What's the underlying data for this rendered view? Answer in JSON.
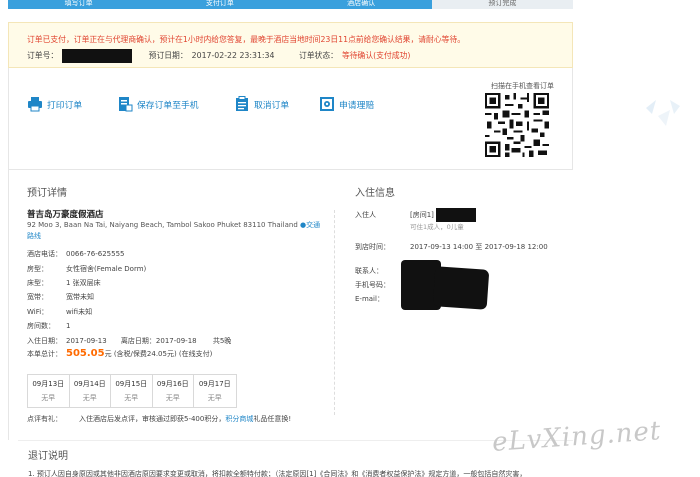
{
  "steps": [
    "填写订单",
    "支付订单",
    "酒店确认",
    "预订完成"
  ],
  "alert": {
    "message": "订单已支付，订单正在与代理商确认，预计在1小时内给您答复，最晚于酒店当地时间23日11点前给您确认结果，请耐心等待。",
    "order_no_label": "订单号：",
    "order_date_label": "预订日期：",
    "order_date": "2017-02-22 23:31:34",
    "order_status_label": "订单状态：",
    "order_status": "等待确认(支付成功)"
  },
  "actions": {
    "print": "打印订单",
    "save": "保存订单至手机",
    "cancel": "取消订单",
    "claim": "申请理赔",
    "qr_label": "扫描在手机查看订单"
  },
  "booking": {
    "section_title": "预订详情",
    "hotel_name": "普吉岛万豪度假酒店",
    "hotel_address": "92 Moo 3, Baan Na Tai, Naiyang Beach, Tambol Sakoo Phuket 83110 Thailand",
    "traffic_link": "交通路线",
    "rows": [
      {
        "k": "酒店电话：",
        "v": "0066-76-625555"
      },
      {
        "k": "房型：",
        "v": "女性宿舍(Female Dorm)"
      },
      {
        "k": "床型：",
        "v": "1 张双层床"
      },
      {
        "k": "宽带：",
        "v": "宽带未知"
      },
      {
        "k": "WiFi：",
        "v": "wifi未知"
      },
      {
        "k": "房间数：",
        "v": "1"
      }
    ],
    "checkin_label": "入住日期：",
    "checkin": "2017-09-13",
    "checkout_label": "离店日期：",
    "checkout": "2017-09-18",
    "nights": "共5晚",
    "total_label": "本单总计：",
    "total_price": "505.05",
    "total_suffix": "元 (含税/保费24.05元) (在线支付)",
    "calendar": [
      {
        "date": "09月13日",
        "status": "无早"
      },
      {
        "date": "09月14日",
        "status": "无早"
      },
      {
        "date": "09月15日",
        "status": "无早"
      },
      {
        "date": "09月16日",
        "status": "无早"
      },
      {
        "date": "09月17日",
        "status": "无早"
      }
    ],
    "review_label": "点评有礼：",
    "review_text": "入住酒店后发点评，审核通过即获5-400积分，",
    "review_link": "积分商城",
    "review_tail": "礼品任意换!"
  },
  "guest": {
    "section_title": "入住信息",
    "guest_label": "入住人",
    "room_label": "[房间1]",
    "room_note": "可住1成人，0儿童",
    "arrival_label": "到店时间：",
    "arrival": "2017-09-13 14:00",
    "arrival_sep": "至",
    "departure": "2017-09-18 12:00",
    "contact_label": "联系人：",
    "phone_label": "手机号码：",
    "email_label": "E-mail："
  },
  "refund": {
    "title": "退订说明",
    "text": "1. 预订人因自身原因或其他非因酒店原因要求变更或取消，将扣款全额特付款；（法定原因[1]《合同法》和《消费者权益保护法》规定方道，一般包括自然灾害，"
  },
  "watermark": "eLvXing.net",
  "colors": {
    "accent": "#1f86c7",
    "alert_red": "#e0432f",
    "price": "#ff6a00",
    "step_active": "#3aa0dd"
  }
}
